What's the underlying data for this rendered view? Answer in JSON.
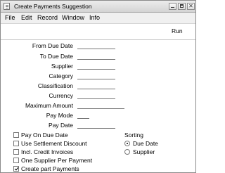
{
  "window": {
    "title": "Create Payments Suggestion"
  },
  "menu": {
    "items": [
      "File",
      "Edit",
      "Record",
      "Window",
      "Info"
    ]
  },
  "toolbar": {
    "run_label": "Run"
  },
  "fields": [
    {
      "label": "From Due Date",
      "value": ""
    },
    {
      "label": "To Due Date",
      "value": ""
    },
    {
      "label": "Supplier",
      "value": ""
    },
    {
      "label": "Category",
      "value": ""
    },
    {
      "label": "Classification",
      "value": ""
    },
    {
      "label": "Currency",
      "value": ""
    },
    {
      "label": "Maximum Amount",
      "value": ""
    },
    {
      "label": "Pay Mode",
      "value": ""
    },
    {
      "label": "Pay Date",
      "value": ""
    }
  ],
  "options": [
    {
      "label": "Pay On Due Date",
      "checked": false
    },
    {
      "label": "Use Settlement Discount",
      "checked": false
    },
    {
      "label": "Incl. Credit Invoices",
      "checked": false
    },
    {
      "label": "One Supplier Per Payment",
      "checked": false
    },
    {
      "label": "Create part Payments",
      "checked": true
    }
  ],
  "sorting": {
    "title": "Sorting",
    "options": [
      {
        "label": "Due Date",
        "selected": true
      },
      {
        "label": "Supplier",
        "selected": false
      }
    ]
  }
}
